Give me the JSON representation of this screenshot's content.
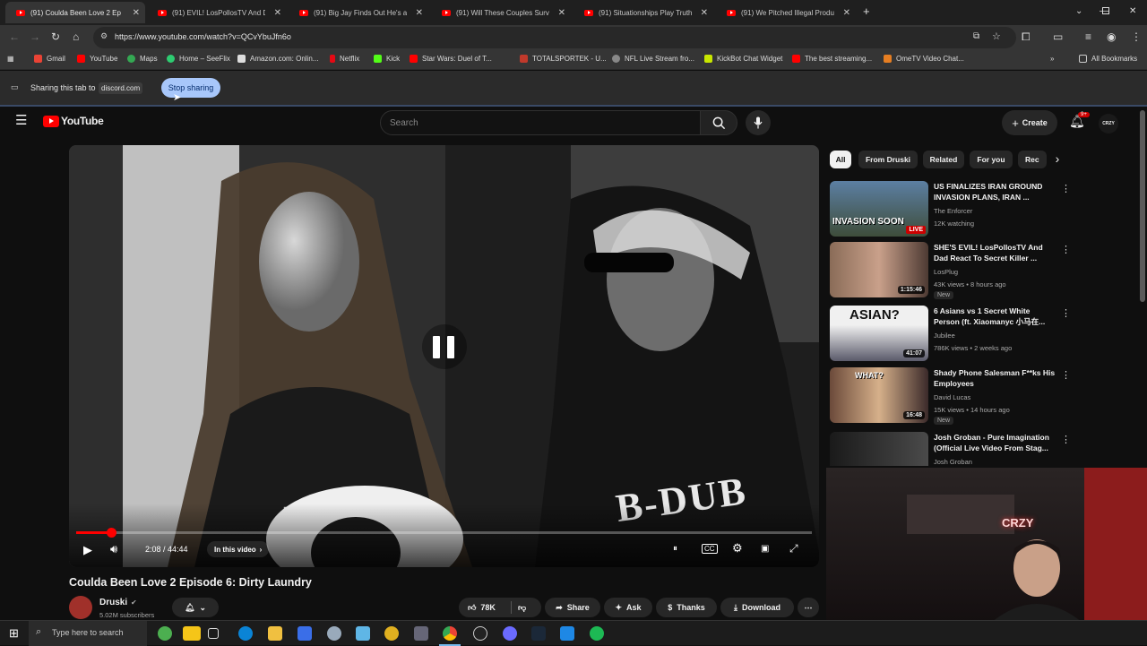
{
  "tabs": [
    {
      "title": "(91) Coulda Been Love 2 Ep",
      "active": true
    },
    {
      "title": "(91) EVIL! LosPollosTV And Dad"
    },
    {
      "title": "(91) Big Jay Finds Out He's a Ch"
    },
    {
      "title": "(91) Will These Couples Survive"
    },
    {
      "title": "(91) Situationships Play Truth or"
    },
    {
      "title": "(91) We Pitched Illegal Product"
    }
  ],
  "toolbar": {
    "url": "https://www.youtube.com/watch?v=QCvYbuJfn6o"
  },
  "bookmarks": [
    "Gmail",
    "YouTube",
    "Maps",
    "Home – SeeFlix",
    "Amazon.com: Onlin...",
    "Netflix",
    "Kick",
    "Star Wars: Duel of T...",
    "TOTALSPORTEK - U...",
    "NFL Live Stream fro...",
    "KickBot Chat Widget",
    "The best streaming...",
    "OmeTV Video Chat...",
    "All Bookmarks"
  ],
  "sharebar": {
    "text": "Sharing this tab to",
    "target": "discord.com",
    "stop_label": "Stop sharing"
  },
  "youtube": {
    "logo_text": "YouTube",
    "search_placeholder": "Search",
    "create_label": "Create",
    "notif_count": "9+",
    "avatar_text": "CRZY"
  },
  "player": {
    "time": "2:08 / 44:44",
    "in_this_video": "In this video",
    "progress_fraction": 0.048,
    "overlay_text": "B-DUB"
  },
  "video": {
    "title": "Coulda Been Love 2 Episode 6: Dirty Laundry",
    "channel": "Druski",
    "subscribers": "5.02M subscribers",
    "likes": "78K",
    "share": "Share",
    "ask": "Ask",
    "thanks": "Thanks",
    "download": "Download"
  },
  "chips": [
    "All",
    "From Druski",
    "Related",
    "For you",
    "Rec"
  ],
  "recommendations": [
    {
      "title": "US FINALIZES IRAN GROUND INVASION PLANS, IRAN ...",
      "channel": "The Enforcer",
      "meta": "12K watching",
      "badge": "LIVE",
      "thumb_text": "INVASION SOON"
    },
    {
      "title": "SHE'S EVIL! LosPollosTV And Dad React To Secret Killer ...",
      "channel": "LosPlug",
      "meta": "43K views • 8 hours ago",
      "duration": "1:15:46",
      "new": "New"
    },
    {
      "title": "6 Asians vs 1 Secret White Person (ft. Xiaomanyc 小马在...",
      "channel": "Jubilee",
      "meta": "786K views • 2 weeks ago",
      "duration": "41:07",
      "thumb_text": "ASIAN?"
    },
    {
      "title": "Shady Phone Salesman F**ks His Employees",
      "channel": "David Lucas",
      "meta": "15K views • 14 hours ago",
      "duration": "16:48",
      "new": "New",
      "thumb_text": "WHAT?"
    },
    {
      "title": "Josh Groban - Pure Imagination (Official Live Video From Stag...",
      "channel": "Josh Groban"
    }
  ],
  "webcam": {
    "sign_text": "CRZY"
  },
  "taskbar": {
    "search_placeholder": "Type here to search"
  }
}
